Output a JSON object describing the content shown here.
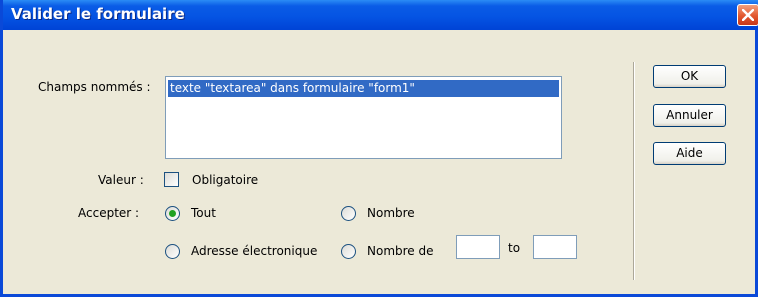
{
  "window": {
    "title": "Valider le formulaire"
  },
  "fields": {
    "named_fields_label": "Champs nommés :",
    "named_fields_items": [
      "texte \"textarea\" dans formulaire \"form1\""
    ],
    "value_label": "Valeur :",
    "required_label": "Obligatoire",
    "required_checked": false,
    "accept_label": "Accepter :",
    "accept_options": {
      "anything": "Tout",
      "number": "Nombre",
      "email": "Adresse électronique",
      "number_from": "Nombre de"
    },
    "accept_selected": "Tout",
    "range_to_label": "to",
    "range_from_value": "",
    "range_to_value": ""
  },
  "buttons": {
    "ok": "OK",
    "cancel": "Annuler",
    "help": "Aide"
  },
  "colors": {
    "title_bar": "#0554e3",
    "selection": "#316ac5",
    "dialog_bg": "#ece9d8",
    "radio_dot": "#21a121"
  }
}
